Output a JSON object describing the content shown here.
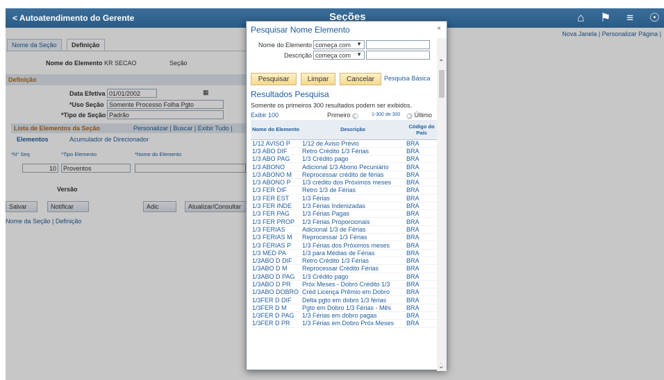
{
  "header": {
    "back_label": "< Autoatendimento do Gerente",
    "title": "Seções",
    "icons": [
      "home-icon",
      "flag-icon",
      "menu-icon",
      "compass-icon"
    ]
  },
  "background": {
    "top_links": "Nova Janela | Personalizar Página |",
    "tabs": [
      "Nome da Seção",
      "Definição"
    ],
    "element_name_label": "Nome do Elemento",
    "element_name_value": "KR SECAO",
    "section_label": "Seção",
    "definition_header": "Definição",
    "effective_date_label": "Data Efetiva",
    "effective_date_value": "01/01/2002",
    "use_label": "*Uso Seção",
    "use_value": "Somente Processo Folha Pgto",
    "type_label": "*Tipo de Seção",
    "type_value": "Padrão",
    "list_title": "Lista de Elementos da Seção",
    "list_links": "Personalizar | Buscar | Exibir Tudo |",
    "subtabs": [
      "Elementos",
      "Acumulador de Direcionador"
    ],
    "col_seq": "*N° Seq",
    "col_type": "*Tipo Elemento",
    "col_name": "*Nome do Elemento",
    "row_seq": "10",
    "row_type": "Proventos",
    "version_label": "Versão",
    "buttons": [
      "Salvar",
      "Notificar",
      "Adic",
      "Atualizar/Consultar"
    ],
    "bottom_links": "Nome da Seção | Definição"
  },
  "modal": {
    "title": "Pesquisar Nome Elemento",
    "close": "×",
    "name_label": "Nome do Elemento",
    "name_operator": "começa com",
    "desc_label": "Descrição",
    "desc_operator": "começa com",
    "buttons": {
      "search": "Pesquisar",
      "clear": "Limpar",
      "cancel": "Cancelar"
    },
    "basic_search_link": "Pesquisa Básica",
    "results_title": "Resultados Pesquisa",
    "results_note": "Somente os primeiros 300 resultados podem ser exibidos.",
    "pager": {
      "show": "Exibir 100",
      "first": "Primeiro",
      "range": "1-300 de 300",
      "last": "Último"
    },
    "columns": [
      "Nome do Elemento",
      "Descrição",
      "Código do País"
    ],
    "rows": [
      [
        "1/12 AVISO P",
        "1/12 de Aviso Prévio",
        "BRA"
      ],
      [
        "1/3 ABO DIF",
        "Retro Crédito 1/3 Férias",
        "BRA"
      ],
      [
        "1/3 ABO PAG",
        "1/3 Crédito pago",
        "BRA"
      ],
      [
        "1/3 ABONO",
        "Adicional 1/3 Abono Pecuniário",
        "BRA"
      ],
      [
        "1/3 ABONO M",
        "Reprocessar crédito de férias",
        "BRA"
      ],
      [
        "1/3 ABONO P",
        "1/3 crédito dos Próximos meses",
        "BRA"
      ],
      [
        "1/3 FER DIF",
        "Retro 1/3 de Férias",
        "BRA"
      ],
      [
        "1/3 FER EST",
        "1/3 Férias",
        "BRA"
      ],
      [
        "1/3 FER INDE",
        "1/3 Férias Indenizadas",
        "BRA"
      ],
      [
        "1/3 FER PAG",
        "1/3 Férias Pagas",
        "BRA"
      ],
      [
        "1/3 FER PROP",
        "1/3 Férias Proporcionais",
        "BRA"
      ],
      [
        "1/3 FERIAS",
        "Adicional 1/3 de Férias",
        "BRA"
      ],
      [
        "1/3 FERIAS M",
        "Reprocessar 1/3 Férias",
        "BRA"
      ],
      [
        "1/3 FERIAS P",
        "1/3 Férias dos Próximos meses",
        "BRA"
      ],
      [
        "1/3 MED PA",
        "1/3 para Médias de Férias",
        "BRA"
      ],
      [
        "1/3ABO D DIF",
        "Retro Crédito 1/3 Férias",
        "BRA"
      ],
      [
        "1/3ABO D M",
        "Reprocessar Crédito Férias",
        "BRA"
      ],
      [
        "1/3ABO D PAG",
        "1/3 Crédito pago",
        "BRA"
      ],
      [
        "1/3ABO D PR",
        "Próx Meses - Dobro Crédito 1/3",
        "BRA"
      ],
      [
        "1/3ABO DOBRO",
        "Créd Licença Prêmio em Dobro",
        "BRA"
      ],
      [
        "1/3FER D DIF",
        "Delta pgto em dobro 1/3 férias",
        "BRA"
      ],
      [
        "1/3FER D M",
        "Pgto em Dobro 1/3 Férias - Mês",
        "BRA"
      ],
      [
        "1/3FER D PAG",
        "1/3 Férias em dobro pagas",
        "BRA"
      ],
      [
        "1/3FER D PR",
        "1/3 Férias em Dobro Próx Meses",
        "BRA"
      ]
    ]
  }
}
